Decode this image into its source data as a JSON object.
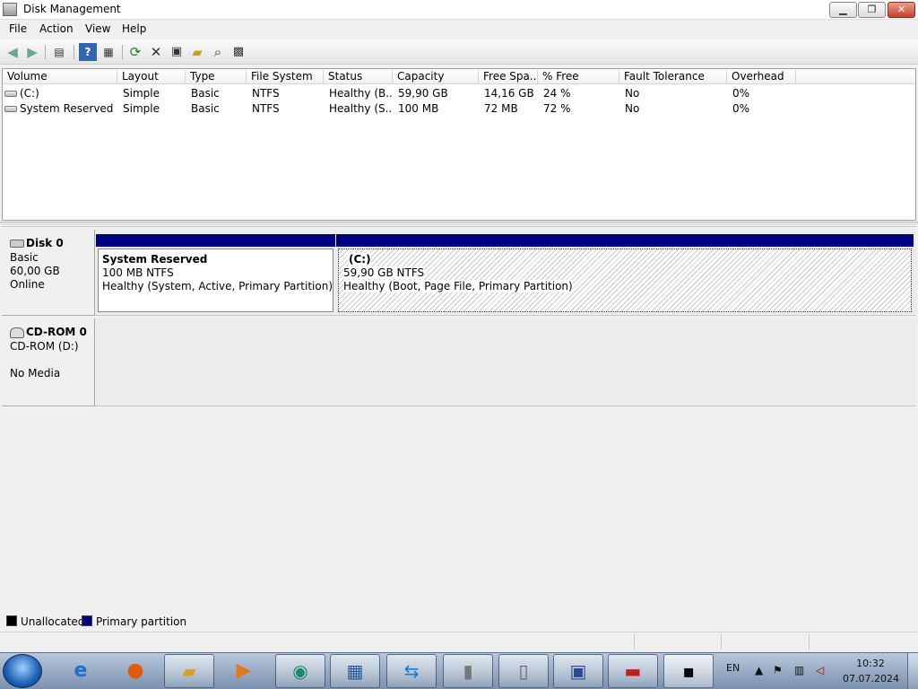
{
  "window": {
    "title": "Disk Management"
  },
  "menu": {
    "file": "File",
    "action": "Action",
    "view": "View",
    "help": "Help"
  },
  "toolbar_icons": [
    "back-icon",
    "forward-icon",
    "show-hide-tree-icon",
    "help-icon",
    "properties-pane-icon",
    "refresh-icon",
    "delete-icon",
    "properties-icon",
    "open-icon",
    "explore-icon",
    "settings-icon"
  ],
  "volume_list": {
    "columns": [
      "Volume",
      "Layout",
      "Type",
      "File System",
      "Status",
      "Capacity",
      "Free Spa...",
      "% Free",
      "Fault Tolerance",
      "Overhead"
    ],
    "rows": [
      [
        "(C:)",
        "Simple",
        "Basic",
        "NTFS",
        "Healthy (B...",
        "59,90 GB",
        "14,16 GB",
        "24 %",
        "No",
        "0%"
      ],
      [
        "System Reserved",
        "Simple",
        "Basic",
        "NTFS",
        "Healthy (S...",
        "100 MB",
        "72 MB",
        "72 %",
        "No",
        "0%"
      ]
    ]
  },
  "disks": {
    "disk0": {
      "name": "Disk 0",
      "type": "Basic",
      "size": "60,00 GB",
      "status": "Online",
      "partitions": [
        {
          "name": "System Reserved",
          "size": "100 MB NTFS",
          "status": "Healthy (System, Active, Primary Partition)"
        },
        {
          "name": "(C:)",
          "size": "59,90 GB NTFS",
          "status": "Healthy (Boot, Page File, Primary Partition)"
        }
      ]
    },
    "cdrom0": {
      "name": "CD-ROM 0",
      "drive": "CD-ROM (D:)",
      "media": "No Media"
    }
  },
  "legend": {
    "unallocated": "Unallocated",
    "primary": "Primary partition"
  },
  "colors": {
    "primary_partition": "#000080",
    "unallocated": "#000000"
  },
  "taskbar": {
    "icons": [
      "start-orb-icon",
      "internet-explorer-icon",
      "firefox-icon",
      "file-explorer-icon",
      "media-player-icon",
      "app-icon",
      "control-panel-icon",
      "remote-app-icon",
      "installer-icon",
      "document-icon",
      "network-admin-icon",
      "toolbox-icon",
      "command-prompt-icon"
    ]
  },
  "tray": {
    "language": "EN",
    "time": "10:32",
    "date": "07.07.2024"
  }
}
